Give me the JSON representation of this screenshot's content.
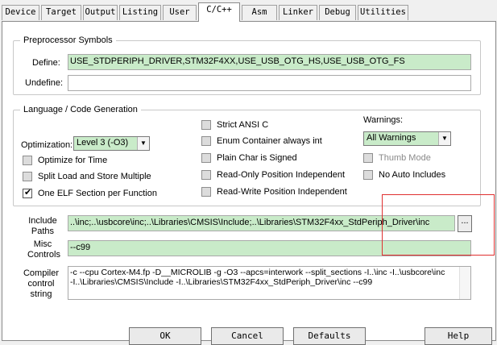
{
  "tabs": [
    "Device",
    "Target",
    "Output",
    "Listing",
    "User",
    "C/C++",
    "Asm",
    "Linker",
    "Debug",
    "Utilities"
  ],
  "preprocessor": {
    "title": "Preprocessor Symbols",
    "define_label": "Define:",
    "define_value": "USE_STDPERIPH_DRIVER,STM32F4XX,USE_USB_OTG_HS,USE_USB_OTG_FS",
    "undefine_label": "Undefine:",
    "undefine_value": ""
  },
  "language": {
    "title": "Language / Code Generation",
    "optimization_label": "Optimization:",
    "optimization_value": "Level 3 (-O3)",
    "warnings_label": "Warnings:",
    "warnings_value": "All Warnings",
    "checkboxes": [
      {
        "label": "Optimize for Time",
        "checked": false,
        "enabled": true
      },
      {
        "label": "Split Load and Store Multiple",
        "checked": false,
        "enabled": true
      },
      {
        "label": "One ELF Section per Function",
        "checked": true,
        "enabled": true
      },
      {
        "label": "Strict ANSI C",
        "checked": false,
        "enabled": true
      },
      {
        "label": "Enum Container always int",
        "checked": false,
        "enabled": true
      },
      {
        "label": "Plain Char is Signed",
        "checked": false,
        "enabled": true
      },
      {
        "label": "Read-Only Position Independent",
        "checked": false,
        "enabled": true
      },
      {
        "label": "Read-Write Position Independent",
        "checked": false,
        "enabled": true
      },
      {
        "label": "Thumb Mode",
        "checked": false,
        "enabled": false
      },
      {
        "label": "No Auto Includes",
        "checked": false,
        "enabled": true
      }
    ]
  },
  "include_paths": {
    "label_line1": "Include",
    "label_line2": "Paths",
    "value": "..\\inc;..\\usbcore\\inc;..\\Libraries\\CMSIS\\Include;..\\Libraries\\STM32F4xx_StdPeriph_Driver\\inc",
    "browse_label": "..."
  },
  "misc_controls": {
    "label_line1": "Misc",
    "label_line2": "Controls",
    "value": "--c99"
  },
  "compiler_string": {
    "label_line1": "Compiler",
    "label_line2": "control",
    "label_line3": "string",
    "line1": "-c --cpu Cortex-M4.fp -D__MICROLIB -g -O3 --apcs=interwork --split_sections -I..\\inc -I..\\usbcore\\inc",
    "line2": "-I..\\Libraries\\CMSIS\\Include -I..\\Libraries\\STM32F4xx_StdPeriph_Driver\\inc --c99"
  },
  "buttons": {
    "ok": "OK",
    "cancel": "Cancel",
    "defaults": "Defaults",
    "help": "Help"
  },
  "colors": {
    "field_green": "#c9ebc9",
    "highlight_red": "#e03030"
  }
}
